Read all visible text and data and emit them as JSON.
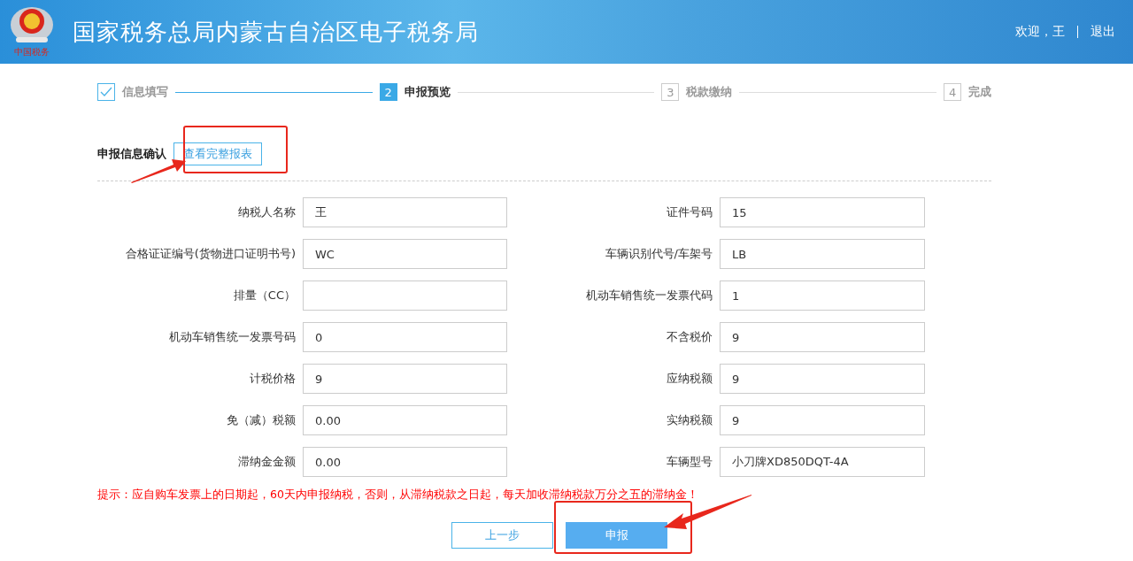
{
  "header": {
    "logo_caption": "中国税务",
    "title": "国家税务总局内蒙古自治区电子税务局",
    "welcome": "欢迎，王",
    "logout": "退出"
  },
  "steps": [
    {
      "label": "信息填写",
      "completed": true,
      "selected": false
    },
    {
      "number": "2",
      "label": "申报预览",
      "completed": false,
      "selected": true
    },
    {
      "number": "3",
      "label": "税款缴纳",
      "completed": false,
      "selected": false
    },
    {
      "number": "4",
      "label": "完成",
      "completed": false,
      "selected": false
    }
  ],
  "section": {
    "title": "申报信息确认",
    "view_button": "查看完整报表"
  },
  "fields": [
    {
      "label": "纳税人名称",
      "value": "王"
    },
    {
      "label": "证件号码",
      "value": "15"
    },
    {
      "label": "合格证证编号(货物进口证明书号)",
      "value": "WC"
    },
    {
      "label": "车辆识别代号/车架号",
      "value": "LB"
    },
    {
      "label": "排量（CC）"
    },
    {
      "label": "机动车销售统一发票代码",
      "value": "1"
    },
    {
      "label": "机动车销售统一发票号码",
      "value": "0"
    },
    {
      "label": "不含税价",
      "value": "9"
    },
    {
      "label": "计税价格",
      "value": "9"
    },
    {
      "label": "应纳税额",
      "value": "9"
    },
    {
      "label": "免（减）税额",
      "value": "0.00"
    },
    {
      "label": "实纳税额",
      "value": "9"
    },
    {
      "label": "滞纳金金额",
      "value": "0.00"
    },
    {
      "label": "车辆型号",
      "value": "小刀牌XD850DQT-4A"
    }
  ],
  "notice": "提示：应自购车发票上的日期起，60天内申报纳税，否则，从滞纳税款之日起，每天加收滞纳税款万分之五的滞纳金！",
  "buttons": [
    {
      "label": "上一步",
      "kind": "secondary"
    },
    {
      "label": "申报",
      "kind": "primary"
    }
  ]
}
